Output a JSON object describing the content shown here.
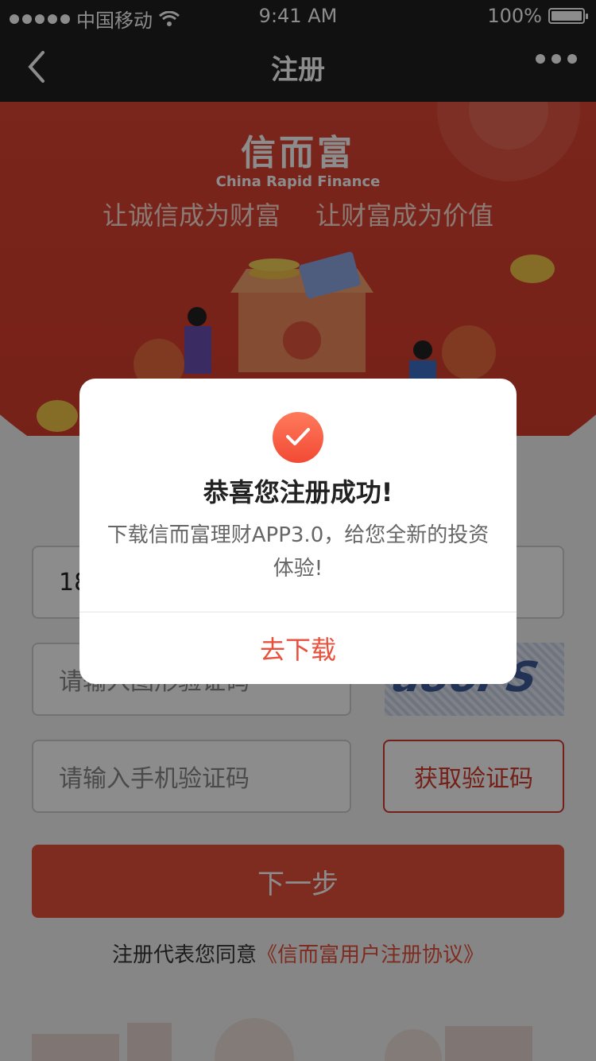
{
  "status_bar": {
    "carrier": "中国移动",
    "time": "9:41 AM",
    "battery": "100%"
  },
  "nav": {
    "title": "注册"
  },
  "hero": {
    "brand_cn": "信而富",
    "brand_en": "China Rapid Finance",
    "slogan_left": "让诚信成为财富",
    "slogan_right": "让财富成为价值"
  },
  "form": {
    "phone_value": "18",
    "captcha_placeholder": "请输入图形验证码",
    "sms_placeholder": "请输入手机验证码",
    "get_code_label": "获取验证码",
    "next_label": "下一步",
    "agree_prefix": "注册代表您同意",
    "agree_link": "《信而富用户注册协议》"
  },
  "dialog": {
    "title": "恭喜您注册成功!",
    "message": "下载信而富理财APP3.0，给您全新的投资体验!",
    "button_label": "去下载"
  },
  "colors": {
    "accent": "#e8503b",
    "nav_bg": "#1f1f1f"
  }
}
